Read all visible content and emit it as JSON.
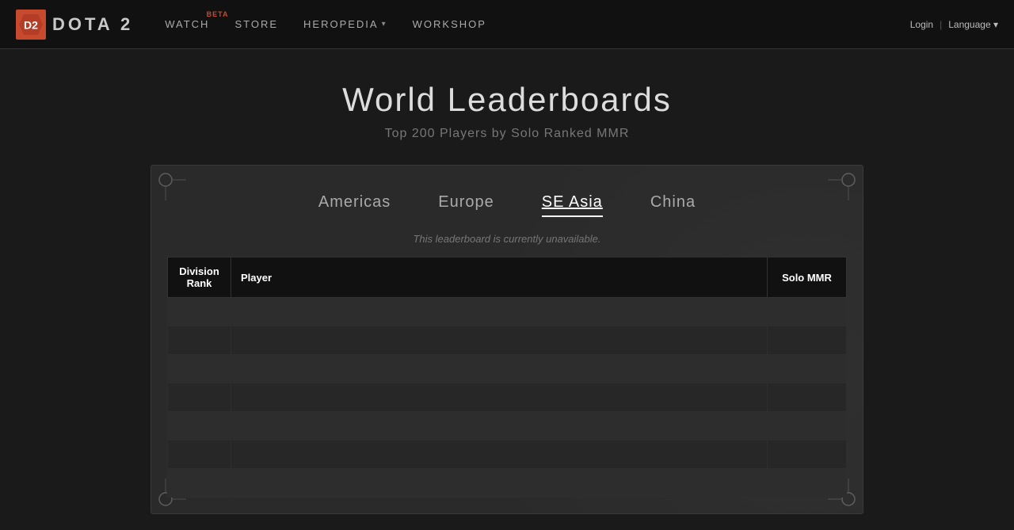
{
  "nav": {
    "logo_text": "DOTA 2",
    "links": [
      {
        "id": "watch",
        "label": "WATCH",
        "beta": "BETA",
        "has_dropdown": false
      },
      {
        "id": "store",
        "label": "STORE",
        "has_dropdown": false
      },
      {
        "id": "heropedia",
        "label": "HEROPEDIA",
        "has_dropdown": true
      },
      {
        "id": "workshop",
        "label": "WORKSHOP",
        "has_dropdown": false
      }
    ],
    "login_label": "Login",
    "language_label": "Language"
  },
  "page": {
    "title": "World Leaderboards",
    "subtitle": "Top 200 Players by Solo Ranked MMR"
  },
  "leaderboard": {
    "unavailable_msg": "This leaderboard is currently unavailable.",
    "regions": [
      {
        "id": "americas",
        "label": "Americas",
        "active": false
      },
      {
        "id": "europe",
        "label": "Europe",
        "active": false
      },
      {
        "id": "se-asia",
        "label": "SE Asia",
        "active": true
      },
      {
        "id": "china",
        "label": "China",
        "active": false
      }
    ],
    "table": {
      "col_rank": "Division\nRank",
      "col_player": "Player",
      "col_mmr": "Solo MMR"
    },
    "rows": [
      {},
      {},
      {},
      {},
      {},
      {},
      {}
    ]
  }
}
